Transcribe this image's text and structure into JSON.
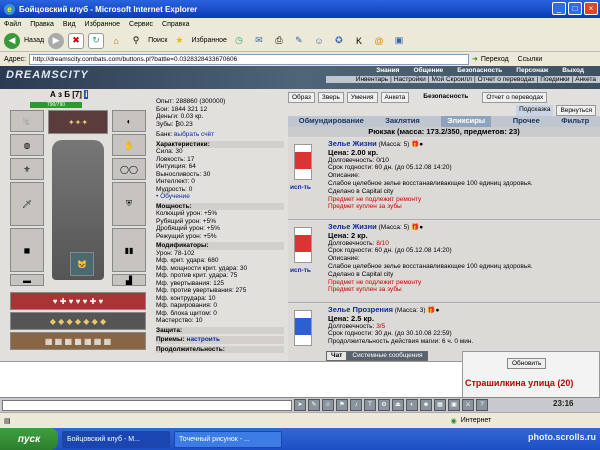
{
  "window": {
    "title": "Бойцовский клуб - Microsoft Internet Explorer"
  },
  "menu": [
    "Файл",
    "Правка",
    "Вид",
    "Избранное",
    "Сервис",
    "Справка"
  ],
  "toolbar": {
    "back": "Назад",
    "search": "Поиск",
    "favorites": "Избранное"
  },
  "address": {
    "label": "Адрес:",
    "url": "http://dreamscity.combats.com/buttons.pl?battle=0.0328328433670606",
    "go": "Переход",
    "links": "Ссылки"
  },
  "site": {
    "logo": "DREAMSCITY",
    "nav_top": [
      "Знания",
      "Общение",
      "Безопасность",
      "Персонаж",
      "Выход"
    ],
    "nav_bottom": [
      "Инвентарь",
      "Настройки",
      "Мой Скроилл",
      "Отчет о переводах",
      "Поединки",
      "Анкета"
    ]
  },
  "character": {
    "name": "А з Б",
    "level": "[7]",
    "hp": "790/790"
  },
  "stats": {
    "exp": "Опыт: 288860 (300000)",
    "battles": "Бои: 1844 321 12",
    "money": "Деньги: 0.03 кр.",
    "teeth": "Зубы: ₿0.23",
    "bank": "Банк:",
    "bank_link": "выбрать счёт",
    "char_header": "Характеристики:",
    "char_lines": [
      "Сила: 30",
      "Ловкость: 17",
      "Интуиция: 64",
      "Выносливость: 30",
      "Интеллект: 0",
      "Мудрость: 0"
    ],
    "training": "• Обучение",
    "power_header": "Мощность:",
    "power_lines": [
      "Колющий урон: +5%",
      "Рубящий урон: +5%",
      "Дробящий урон: +5%",
      "Режущий урон: +5%"
    ],
    "mod_header": "Модификаторы:",
    "mod_lines": [
      "Урон: 78-102",
      "Мф. крит. удара: 680",
      "Мф. мощности крит. удара: 30",
      "Мф. против крит. удара: 75",
      "Мф. увертывания: 125",
      "Мф. против увертывания: 275",
      "Мф. контрудара: 10",
      "Мф. парирования: 0",
      "Мф. блока щитом: 0",
      "Мастерство: 10"
    ],
    "defense_header": "Защита:",
    "techniques_header": "Приемы:",
    "techniques_link": "настроить",
    "more_header": "Продолжительность:"
  },
  "top_buttons": [
    "Образ",
    "Зверь",
    "Умения",
    "Анкета"
  ],
  "security_label": "Безопасность",
  "report_button": "Отчет о переводах",
  "hint_button": "Подсказка",
  "return_button": "Вернуться",
  "tabs": [
    "Обмундирование",
    "Заклятия",
    "Эликсиры",
    "Прочее",
    "Фильтр"
  ],
  "backpack": "Рюкзак (масса: 173.2/350, предметов: 23)",
  "items": [
    {
      "name": "Зелье Жизни",
      "mass": "(Масса: 5)",
      "price": "Цена: 2.00 кр.",
      "durability_label": "Долговечность:",
      "durability": "0/10",
      "expiry": "Срок годности: 60 дн. (до 05.12.08 14:20)",
      "desc_label": "Описание:",
      "desc": "Слабое целебное зелье восстанавливающее 100 единиц здоровья.",
      "made": "Сделано в Capital city",
      "note1": "Предмет не подлежит ремонту",
      "note2": "Предмет куплен за зубы",
      "use": "исп-ть"
    },
    {
      "name": "Зелье Жизни",
      "mass": "(Масса: 5)",
      "price": "Цена: 2 кр.",
      "durability_label": "Долговечность:",
      "durability": "8/10",
      "expiry": "Срок годности: 60 дн. (до 05.12.08 14:20)",
      "desc_label": "Описание:",
      "desc": "Слабое целебное зелье восстанавливающее 100 единиц здоровья.",
      "made": "Сделано в Capital city",
      "note1": "Предмет не подлежит ремонту",
      "note2": "Предмет куплен за зубы",
      "use": "исп-ть"
    },
    {
      "name": "Зелье Прозрения",
      "mass": "(Масса: 3)",
      "price": "Цена: 2.5 кр.",
      "durability_label": "Долговечность:",
      "durability": "3/5",
      "expiry": "Срок годности: 30 дн. (до 30.10.08 22:59)",
      "duration": "Продолжительность действия магии: 6 ч. 0 мин.",
      "use": "исп-ть"
    }
  ],
  "chat_tabs": [
    "Чат",
    "Системные сообщения"
  ],
  "online": {
    "refresh": "Обновить",
    "street": "Страшилкина улица (20)"
  },
  "clock": "23:16",
  "status": {
    "zone": "Интернет"
  },
  "taskbar": {
    "start": "пуск",
    "tasks": [
      "Бойцовский клуб - M...",
      "Точечный рисунок - ..."
    ]
  },
  "watermark": "photo.scrolls.ru",
  "colors": {
    "title_blue": "#0b3bb7",
    "link_blue": "#0b2a9a",
    "warn_red": "#c00",
    "hp_green": "#2e9a2e"
  }
}
